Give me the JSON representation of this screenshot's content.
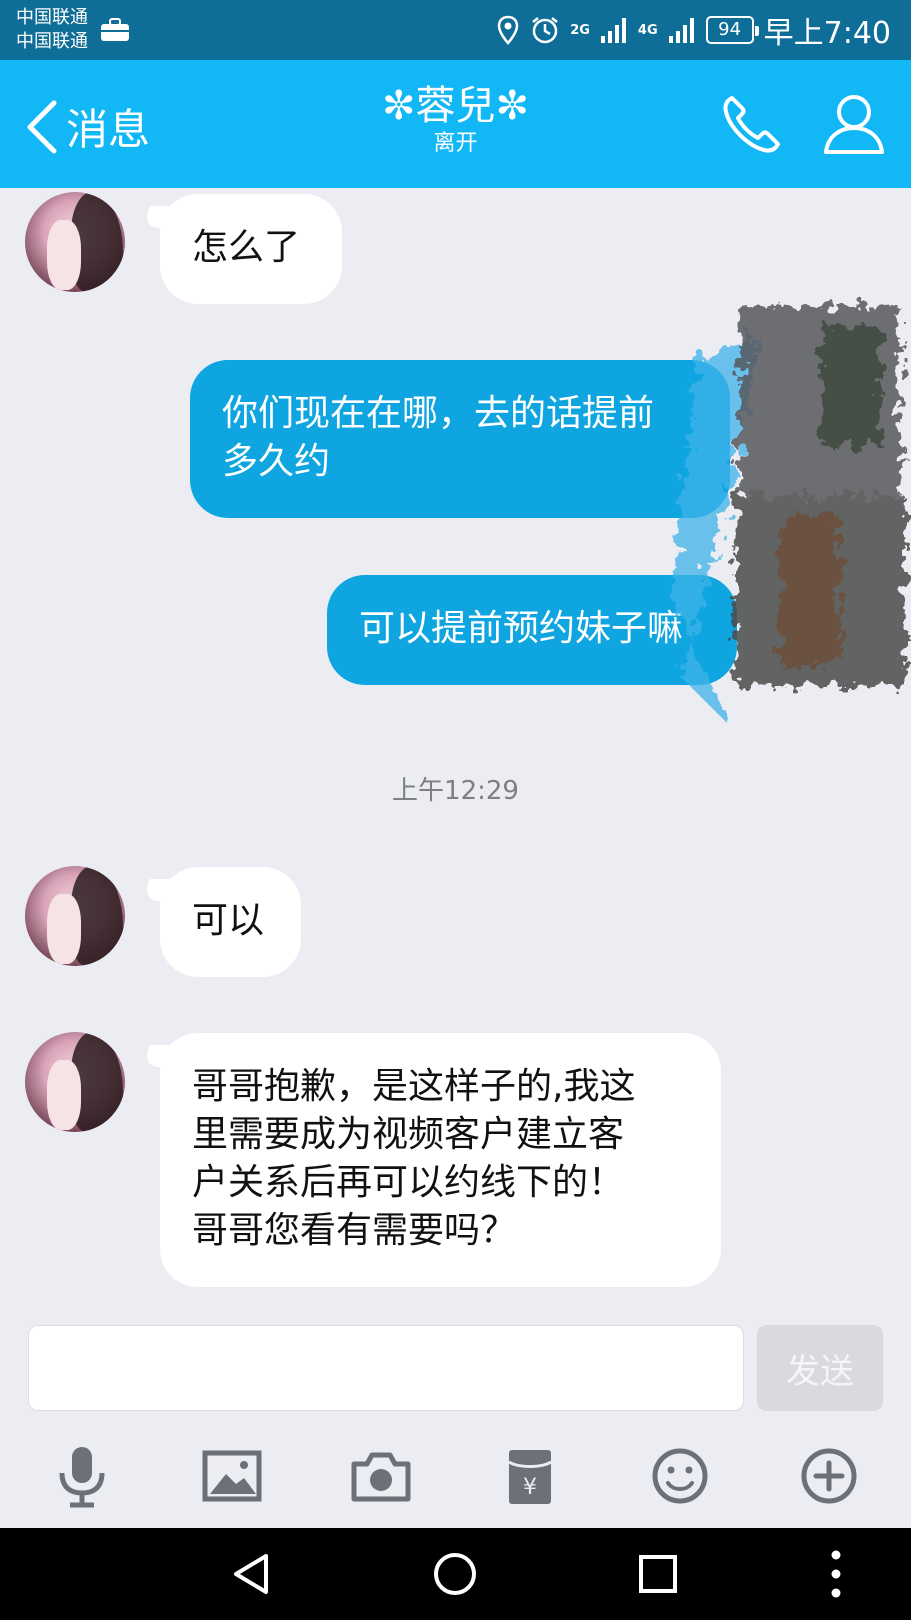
{
  "status_bar": {
    "carrier_1": "中国联通",
    "carrier_2": "中国联通",
    "network_1": "2G",
    "network_2": "4G",
    "battery": "94",
    "time": "早上7:40"
  },
  "header": {
    "back_label": "消息",
    "title": "✼蓉兒✼",
    "status": "离开"
  },
  "messages": [
    {
      "direction": "incoming",
      "text": "怎么了"
    },
    {
      "direction": "outgoing",
      "lines": [
        "你们现在在哪，去的话提前",
        "多久约"
      ]
    },
    {
      "direction": "outgoing",
      "text": "可以提前预约妹子嘛"
    },
    {
      "direction": "incoming",
      "text": "可以"
    },
    {
      "direction": "incoming",
      "lines": [
        "哥哥抱歉，是这样子的,我这",
        "里需要成为视频客户建立客",
        "户关系后再可以约线下的！",
        "哥哥您看有需要吗？"
      ]
    }
  ],
  "timestamp": "上午12:29",
  "composer": {
    "send_label": "发送"
  },
  "toolbar": {
    "icons": [
      "microphone-icon",
      "image-icon",
      "camera-icon",
      "red-packet-icon",
      "emoji-icon",
      "plus-icon"
    ]
  },
  "colors": {
    "header_bg": "#12b7f5",
    "statusbar_bg": "#0f6e98",
    "outgoing_bubble": "#0ea5e0",
    "incoming_bubble": "#ffffff",
    "chat_bg": "#ebedf2"
  }
}
